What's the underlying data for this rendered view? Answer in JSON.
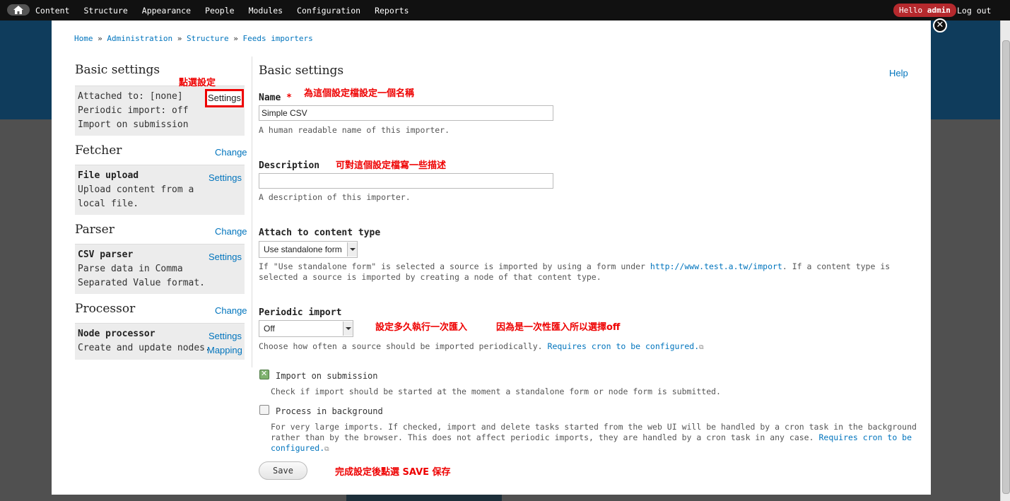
{
  "toolbar": {
    "home_icon": "home-icon",
    "menu": [
      "Content",
      "Structure",
      "Appearance",
      "People",
      "Modules",
      "Configuration",
      "Reports"
    ],
    "hello_prefix": "Hello",
    "username": "admin",
    "logout": "Log out"
  },
  "overlay": {
    "close_icon": "close-icon",
    "breadcrumb": [
      "Home",
      "Administration",
      "Structure",
      "Feeds importers"
    ]
  },
  "sidebar": {
    "basic": {
      "title": "Basic settings",
      "lines": [
        "Attached to: [none]",
        "Periodic import: off",
        "Import on submission"
      ],
      "settings": "Settings"
    },
    "fetcher": {
      "title": "Fetcher",
      "change": "Change",
      "name": "File upload",
      "desc1": "Upload content from a",
      "desc2": "local file.",
      "settings": "Settings"
    },
    "parser": {
      "title": "Parser",
      "change": "Change",
      "name": "CSV parser",
      "desc1": "Parse data in Comma",
      "desc2": "Separated Value format.",
      "settings": "Settings"
    },
    "processor": {
      "title": "Processor",
      "change": "Change",
      "name": "Node processor",
      "desc1": "Create and update nodes.",
      "settings": "Settings",
      "mapping": "Mapping"
    }
  },
  "form": {
    "title": "Basic settings",
    "help": "Help",
    "name": {
      "label": "Name",
      "required": "*",
      "value": "Simple CSV",
      "desc": "A human readable name of this importer."
    },
    "description": {
      "label": "Description",
      "value": "",
      "desc": "A description of this importer."
    },
    "attach": {
      "label": "Attach to content type",
      "selected": "Use standalone form",
      "desc_pre": "If \"Use standalone form\" is selected a source is imported by using a form under",
      "desc_link": "http://www.test.a.tw/import",
      "desc_post": ". If a content type is",
      "desc_line2": "selected a source is imported by creating a node of that content type."
    },
    "periodic": {
      "label": "Periodic import",
      "selected": "Off",
      "desc": "Choose how often a source should be imported periodically.",
      "link": "Requires cron to be configured."
    },
    "import_on_submission": {
      "label": "Import on submission",
      "checked": true,
      "desc": "Check if import should be started at the moment a standalone form or node form is submitted."
    },
    "process_background": {
      "label": "Process in background",
      "checked": false,
      "desc1": "For very large imports. If checked, import and delete tasks started from the web UI will be handled by a cron task in the background",
      "desc2": "rather than by the browser. This does not affect periodic imports, they are handled by a cron task in any case.",
      "link1": "Requires cron to be",
      "link2": "configured."
    },
    "save": "Save"
  },
  "annotations": {
    "settings_hint": "點選設定",
    "name_hint": "為這個設定檔設定一個名稱",
    "desc_hint": "可對這個設定檔寫一些描述",
    "periodic_hint1": "設定多久執行一次匯入",
    "periodic_hint2": "因為是一次性匯入所以選擇off",
    "save_hint": "完成設定後點選 SAVE 保存"
  },
  "colors": {
    "toolbar": "#111111",
    "hello_badge": "#b5292d",
    "link": "#0074bd",
    "annotation": "#ee0000",
    "checkbox_checked": "#7fb26f"
  }
}
